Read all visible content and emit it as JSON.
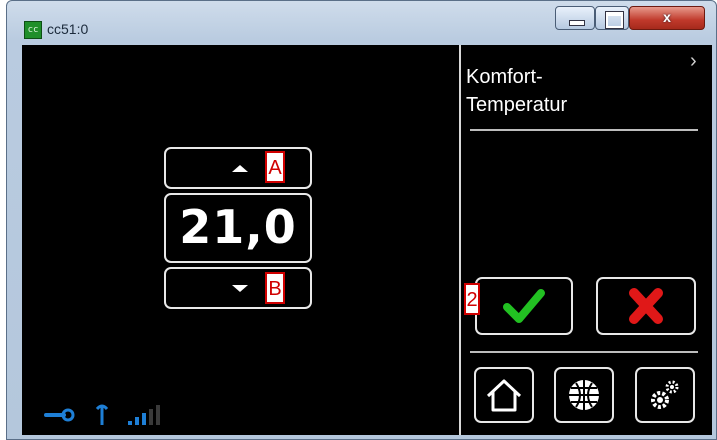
{
  "window": {
    "title": "cc51:0",
    "app_icon_text": "cc",
    "controls": {
      "close_glyph": "x"
    }
  },
  "setpoint": {
    "value": "21,0"
  },
  "annotations": {
    "a": "A",
    "b": "B",
    "two": "2"
  },
  "panel": {
    "title_line1": "Komfort-",
    "title_line2": "Temperatur",
    "more_glyph": "›"
  },
  "colors": {
    "confirm": "#22c022",
    "cancel": "#e01818",
    "status_icons": "#1e7fd6",
    "annotation": "#d00000"
  },
  "icons": {
    "confirm": "checkmark-icon",
    "cancel": "x-icon",
    "home": "house-icon",
    "mode": "globe-icon",
    "settings": "gears-icon",
    "status": [
      "wrench-icon",
      "antenna-icon",
      "signal-bars-icon"
    ]
  },
  "status": {
    "signal_level": 3,
    "signal_max": 5
  }
}
